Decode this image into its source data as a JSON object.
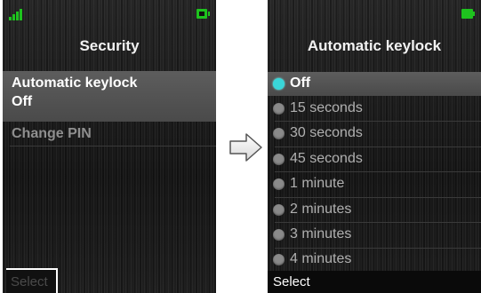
{
  "left_screen": {
    "title": "Security",
    "items": [
      {
        "label": "Automatic keylock",
        "value": "Off",
        "selected": true
      },
      {
        "label": "Change PIN",
        "selected": false
      }
    ],
    "softkey": "Select"
  },
  "right_screen": {
    "title": "Automatic keylock",
    "options": [
      {
        "label": "Off",
        "checked": true
      },
      {
        "label": "15 seconds",
        "checked": false
      },
      {
        "label": "30 seconds",
        "checked": false
      },
      {
        "label": "45 seconds",
        "checked": false
      },
      {
        "label": "1 minute",
        "checked": false
      },
      {
        "label": "2 minutes",
        "checked": false
      },
      {
        "label": "3 minutes",
        "checked": false
      },
      {
        "label": "4 minutes",
        "checked": false
      }
    ],
    "softkey": "Select"
  },
  "icons": {
    "signal": "signal-strength-icon",
    "battery": "battery-icon",
    "arrow": "right-arrow-icon"
  },
  "colors": {
    "accent_radio": "#39d6d8",
    "status_green": "#1ec21e",
    "selection_bar": "#555555"
  }
}
